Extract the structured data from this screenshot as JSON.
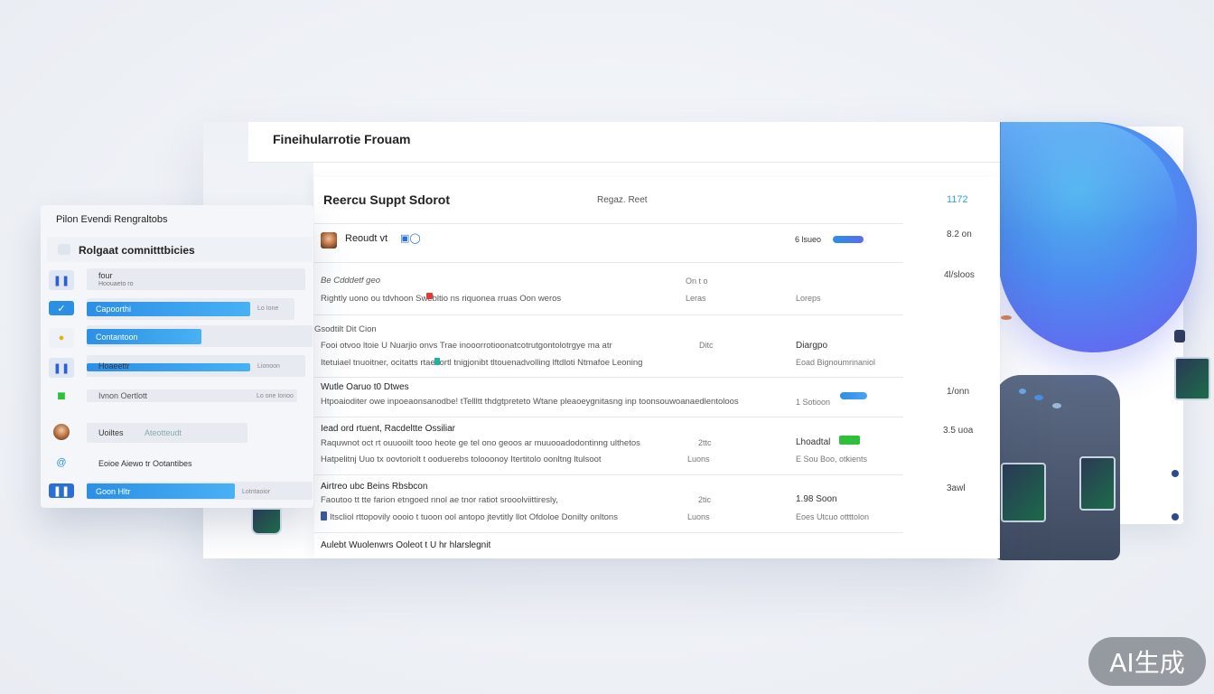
{
  "window": {
    "title": "Fineihularrotie Frouam"
  },
  "panel": {
    "title": "Reercu Suppt Sdorot",
    "subtitle": "Regaz. Reet",
    "count": "1172"
  },
  "rows": [
    {
      "head": "Reoudt vt",
      "badge": "6 lsueo",
      "right": "8.2 on"
    },
    {
      "head": "Be Cdddetf geo",
      "line": "Rightly uono ou tdvhoon Swebltio ns riquonea rruas Oon weros",
      "meta1": "On t o",
      "meta2": "Leras",
      "num": "Loreps",
      "right": "4l/sloos"
    },
    {
      "head": "Gsodtilt Dit Cion",
      "line": "Fooi otvoo ltoie U Nuarjio onvs Trae inooorrotioonatcotrutgontolotrgye ma atr",
      "line2": "Itetuiael tnuoitner, ocitatts rtaecortl tnigjonibt tltouenadvolling lftdloti Ntmafoe Leoning",
      "meta1": "Ditc",
      "meta2": "",
      "num": "Diargpo",
      "num2": "Eoad Bignoumrinaniol",
      "right": ""
    },
    {
      "head": "Wutle Oaruo t0 Dtwes",
      "line": "Htpoaioditer owe inpoeaonsanodbe! tTellltt thdgtpreteto Wtane pleaoeygnitasng inp toonsouwoanaedlentoloos",
      "num": "1 Sotioon",
      "right": "1/onn"
    },
    {
      "head": "Iead ord rtuent, Racdeltte Ossiliar",
      "line": "Raquwnot oct rt ouuooilt tooo heote ge tel ono geoos ar muuooadodontinng ulthetos",
      "line2": "Hatpelitnj Uuo tx oovtoriolt t ooduerebs tolooonoy Itertitolo oonltng ltulsoot",
      "meta1": "2ttc",
      "meta2": "Luons",
      "num": "Lhoadtal",
      "num2": "E Sou Boo, otkients",
      "right": "3.5 uoa"
    },
    {
      "head": "Airtreo ubc Beins Rbsbcon",
      "line": "Faoutoo tt tte farion etngoed nnol ae tnor ratiot srooolviittiresly,",
      "line2": "Itscliol rttopovily oooio t tuoon ool antopo jtevtitly llot Ofdoloe Donilty onltons",
      "meta1": "2tic",
      "meta2": "Luons",
      "num": "1.98 Soon",
      "num2": "Eoes Utcuo ottttolon",
      "right": "3awl"
    },
    {
      "head": "Aulebt Wuolenwrs Ooleot t U hr hlarslegnit"
    }
  ],
  "overlay": {
    "title": "Pilon Evendi Rengraltobs",
    "subtitle": "Rolgaat comnitttbicies",
    "items": [
      {
        "label": "four",
        "label2": "Hoouaeto ro",
        "fill": 0.0,
        "tail": ""
      },
      {
        "label": "Capoorthi",
        "fill": 0.74,
        "tail": "Lo Ione"
      },
      {
        "label": "Contantoon",
        "fill": 0.52,
        "tail": ""
      },
      {
        "label": "Hoaeettr",
        "fill": 0.74,
        "tail": "Lionoon"
      },
      {
        "label": "Ivnon Oertlott",
        "fill": 0.0,
        "tail": "Lo one Ionoo"
      },
      {
        "label": "Uoiltes",
        "label2": "Ateotteudt",
        "fill": 0.0,
        "tail": ""
      },
      {
        "label": "Eoioe Aiewo tr Ootantibes",
        "fill": 0.0,
        "tail": ""
      },
      {
        "label": "Goon Hltr",
        "fill": 0.67,
        "tail": "Lotntaoior"
      }
    ]
  },
  "watermark": "AI生成",
  "colors": {
    "accent": "#35a0e6",
    "bar": "#2b8fe6",
    "green": "#2fbf3a",
    "blob": "#4d8cf0"
  }
}
